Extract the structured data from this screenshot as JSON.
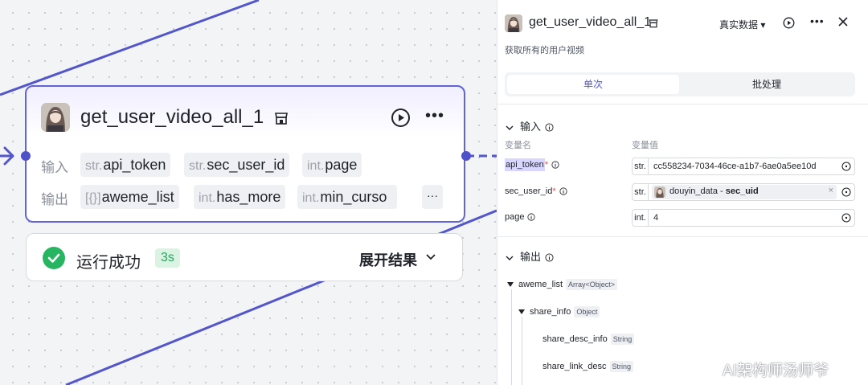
{
  "canvas_node": {
    "title": "get_user_video_all_1",
    "inputs_label": "输入",
    "outputs_label": "输出",
    "inputs": [
      {
        "type": "str.",
        "name": "api_token"
      },
      {
        "type": "str.",
        "name": "sec_user_id"
      },
      {
        "type": "int.",
        "name": "page"
      }
    ],
    "outputs": [
      {
        "type": "[{}]",
        "name": "aweme_list"
      },
      {
        "type": "int.",
        "name": "has_more"
      },
      {
        "type": "int.",
        "name": "min_curso"
      }
    ],
    "more_outputs": "···",
    "icons": {
      "avatar": "anime-girl-avatar",
      "title_icon": "plugin-store-icon",
      "run": "play-circle-icon",
      "more": "more-horizontal-icon"
    }
  },
  "result": {
    "status": "运行成功",
    "duration": "3s",
    "expand_label": "展开结果",
    "colors": {
      "success": "#27b562"
    }
  },
  "panel": {
    "title": "get_user_video_all_1",
    "mode": "真实数据",
    "description": "获取所有的用户视频",
    "tabs": [
      {
        "label": "单次",
        "active": true
      },
      {
        "label": "批处理",
        "active": false
      }
    ],
    "input_section": {
      "title": "输入",
      "col_name": "变量名",
      "col_value": "变量值",
      "params": [
        {
          "name": "api_token",
          "required": "*",
          "type": "str.",
          "value": "cc558234-7034-46ce-a1b7-6ae0a5ee10d"
        },
        {
          "name": "sec_user_id",
          "required": "*",
          "type": "str.",
          "chip_source": "douyin_data",
          "chip_sep": " - ",
          "chip_field": "sec_uid",
          "chip_clear": "×"
        },
        {
          "name": "page",
          "required": "",
          "type": "int.",
          "value": "4"
        }
      ]
    },
    "output_section": {
      "title": "输出",
      "tree": [
        {
          "name": "aweme_list",
          "type": "Array<Object>"
        },
        {
          "name": "share_info",
          "type": "Object"
        },
        {
          "name": "share_desc_info",
          "type": "String"
        },
        {
          "name": "share_link_desc",
          "type": "String"
        }
      ]
    },
    "accent": "#4d53e8"
  },
  "watermark": "AI架构师汤师爷"
}
